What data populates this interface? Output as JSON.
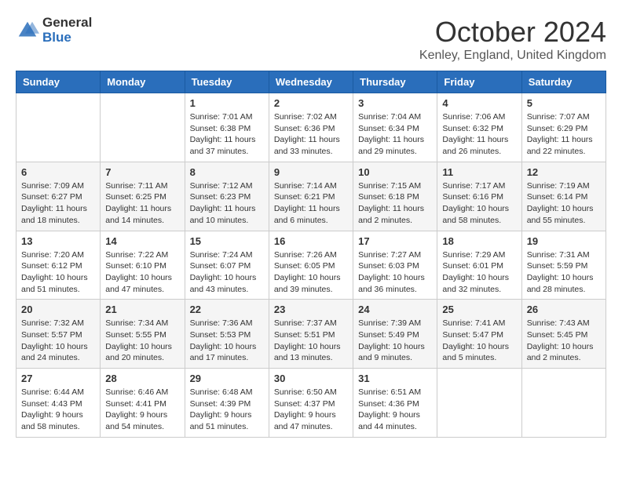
{
  "logo": {
    "general": "General",
    "blue": "Blue"
  },
  "header": {
    "month": "October 2024",
    "location": "Kenley, England, United Kingdom"
  },
  "weekdays": [
    "Sunday",
    "Monday",
    "Tuesday",
    "Wednesday",
    "Thursday",
    "Friday",
    "Saturday"
  ],
  "weeks": [
    [
      null,
      null,
      {
        "day": "1",
        "sunrise": "Sunrise: 7:01 AM",
        "sunset": "Sunset: 6:38 PM",
        "daylight": "Daylight: 11 hours and 37 minutes."
      },
      {
        "day": "2",
        "sunrise": "Sunrise: 7:02 AM",
        "sunset": "Sunset: 6:36 PM",
        "daylight": "Daylight: 11 hours and 33 minutes."
      },
      {
        "day": "3",
        "sunrise": "Sunrise: 7:04 AM",
        "sunset": "Sunset: 6:34 PM",
        "daylight": "Daylight: 11 hours and 29 minutes."
      },
      {
        "day": "4",
        "sunrise": "Sunrise: 7:06 AM",
        "sunset": "Sunset: 6:32 PM",
        "daylight": "Daylight: 11 hours and 26 minutes."
      },
      {
        "day": "5",
        "sunrise": "Sunrise: 7:07 AM",
        "sunset": "Sunset: 6:29 PM",
        "daylight": "Daylight: 11 hours and 22 minutes."
      }
    ],
    [
      {
        "day": "6",
        "sunrise": "Sunrise: 7:09 AM",
        "sunset": "Sunset: 6:27 PM",
        "daylight": "Daylight: 11 hours and 18 minutes."
      },
      {
        "day": "7",
        "sunrise": "Sunrise: 7:11 AM",
        "sunset": "Sunset: 6:25 PM",
        "daylight": "Daylight: 11 hours and 14 minutes."
      },
      {
        "day": "8",
        "sunrise": "Sunrise: 7:12 AM",
        "sunset": "Sunset: 6:23 PM",
        "daylight": "Daylight: 11 hours and 10 minutes."
      },
      {
        "day": "9",
        "sunrise": "Sunrise: 7:14 AM",
        "sunset": "Sunset: 6:21 PM",
        "daylight": "Daylight: 11 hours and 6 minutes."
      },
      {
        "day": "10",
        "sunrise": "Sunrise: 7:15 AM",
        "sunset": "Sunset: 6:18 PM",
        "daylight": "Daylight: 11 hours and 2 minutes."
      },
      {
        "day": "11",
        "sunrise": "Sunrise: 7:17 AM",
        "sunset": "Sunset: 6:16 PM",
        "daylight": "Daylight: 10 hours and 58 minutes."
      },
      {
        "day": "12",
        "sunrise": "Sunrise: 7:19 AM",
        "sunset": "Sunset: 6:14 PM",
        "daylight": "Daylight: 10 hours and 55 minutes."
      }
    ],
    [
      {
        "day": "13",
        "sunrise": "Sunrise: 7:20 AM",
        "sunset": "Sunset: 6:12 PM",
        "daylight": "Daylight: 10 hours and 51 minutes."
      },
      {
        "day": "14",
        "sunrise": "Sunrise: 7:22 AM",
        "sunset": "Sunset: 6:10 PM",
        "daylight": "Daylight: 10 hours and 47 minutes."
      },
      {
        "day": "15",
        "sunrise": "Sunrise: 7:24 AM",
        "sunset": "Sunset: 6:07 PM",
        "daylight": "Daylight: 10 hours and 43 minutes."
      },
      {
        "day": "16",
        "sunrise": "Sunrise: 7:26 AM",
        "sunset": "Sunset: 6:05 PM",
        "daylight": "Daylight: 10 hours and 39 minutes."
      },
      {
        "day": "17",
        "sunrise": "Sunrise: 7:27 AM",
        "sunset": "Sunset: 6:03 PM",
        "daylight": "Daylight: 10 hours and 36 minutes."
      },
      {
        "day": "18",
        "sunrise": "Sunrise: 7:29 AM",
        "sunset": "Sunset: 6:01 PM",
        "daylight": "Daylight: 10 hours and 32 minutes."
      },
      {
        "day": "19",
        "sunrise": "Sunrise: 7:31 AM",
        "sunset": "Sunset: 5:59 PM",
        "daylight": "Daylight: 10 hours and 28 minutes."
      }
    ],
    [
      {
        "day": "20",
        "sunrise": "Sunrise: 7:32 AM",
        "sunset": "Sunset: 5:57 PM",
        "daylight": "Daylight: 10 hours and 24 minutes."
      },
      {
        "day": "21",
        "sunrise": "Sunrise: 7:34 AM",
        "sunset": "Sunset: 5:55 PM",
        "daylight": "Daylight: 10 hours and 20 minutes."
      },
      {
        "day": "22",
        "sunrise": "Sunrise: 7:36 AM",
        "sunset": "Sunset: 5:53 PM",
        "daylight": "Daylight: 10 hours and 17 minutes."
      },
      {
        "day": "23",
        "sunrise": "Sunrise: 7:37 AM",
        "sunset": "Sunset: 5:51 PM",
        "daylight": "Daylight: 10 hours and 13 minutes."
      },
      {
        "day": "24",
        "sunrise": "Sunrise: 7:39 AM",
        "sunset": "Sunset: 5:49 PM",
        "daylight": "Daylight: 10 hours and 9 minutes."
      },
      {
        "day": "25",
        "sunrise": "Sunrise: 7:41 AM",
        "sunset": "Sunset: 5:47 PM",
        "daylight": "Daylight: 10 hours and 5 minutes."
      },
      {
        "day": "26",
        "sunrise": "Sunrise: 7:43 AM",
        "sunset": "Sunset: 5:45 PM",
        "daylight": "Daylight: 10 hours and 2 minutes."
      }
    ],
    [
      {
        "day": "27",
        "sunrise": "Sunrise: 6:44 AM",
        "sunset": "Sunset: 4:43 PM",
        "daylight": "Daylight: 9 hours and 58 minutes."
      },
      {
        "day": "28",
        "sunrise": "Sunrise: 6:46 AM",
        "sunset": "Sunset: 4:41 PM",
        "daylight": "Daylight: 9 hours and 54 minutes."
      },
      {
        "day": "29",
        "sunrise": "Sunrise: 6:48 AM",
        "sunset": "Sunset: 4:39 PM",
        "daylight": "Daylight: 9 hours and 51 minutes."
      },
      {
        "day": "30",
        "sunrise": "Sunrise: 6:50 AM",
        "sunset": "Sunset: 4:37 PM",
        "daylight": "Daylight: 9 hours and 47 minutes."
      },
      {
        "day": "31",
        "sunrise": "Sunrise: 6:51 AM",
        "sunset": "Sunset: 4:36 PM",
        "daylight": "Daylight: 9 hours and 44 minutes."
      },
      null,
      null
    ]
  ]
}
